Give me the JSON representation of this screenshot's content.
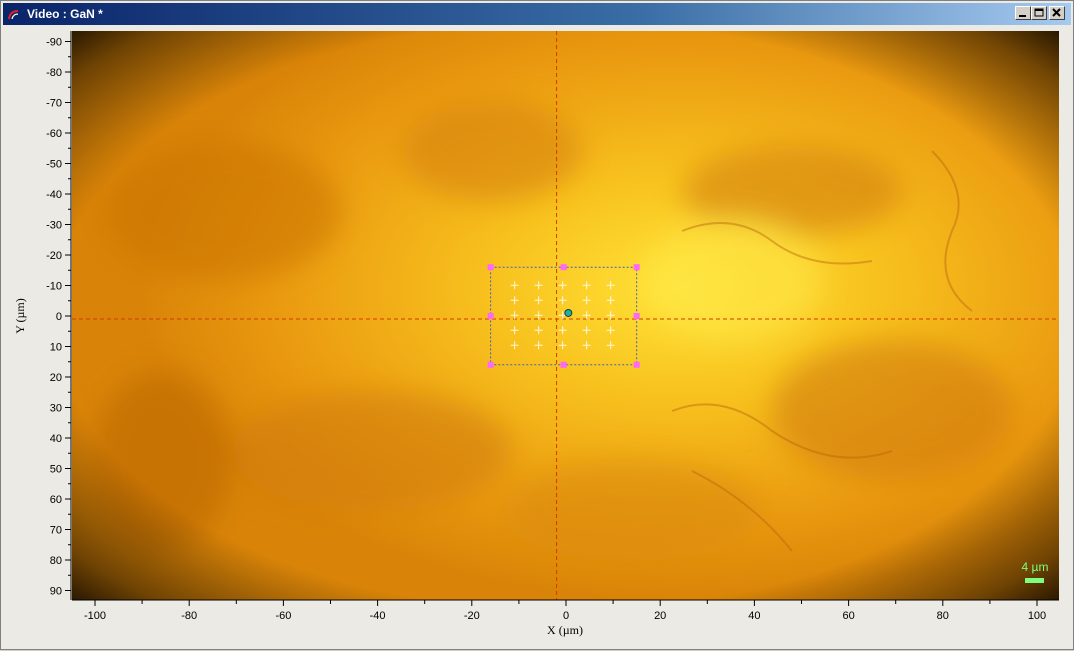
{
  "window": {
    "title": "Video : GaN *",
    "buttons": [
      "minimize",
      "restore",
      "close"
    ]
  },
  "axes": {
    "x_label": "X (µm)",
    "y_label": "Y (µm)",
    "x_ticks": [
      "-100",
      "-80",
      "-60",
      "-40",
      "-20",
      "0",
      "20",
      "40",
      "60",
      "80",
      "100"
    ],
    "y_ticks": [
      "-90",
      "-80",
      "-70",
      "-60",
      "-50",
      "-40",
      "-30",
      "-20",
      "-10",
      "0",
      "10",
      "20",
      "30",
      "40",
      "50",
      "60",
      "70",
      "80",
      "90"
    ]
  },
  "scale_bar": {
    "label": "4 µm",
    "color": "#7cff7c"
  },
  "crosshair": {
    "x": -2,
    "y": 1,
    "color": "#d43a00"
  },
  "selection": {
    "x_range": [
      -16,
      15
    ],
    "y_range": [
      -16,
      16
    ],
    "grid_cols": 5,
    "grid_rows": 5,
    "handle_color": "#ff66ff",
    "center_marker_color": "#20b0a0"
  },
  "colors": {
    "image_base": "#e6940e",
    "image_highlight": "#ffe030",
    "vignette": "#1a0f00"
  },
  "icons": {
    "title": "video-icon",
    "minimize": "minimize-icon",
    "restore": "restore-icon",
    "close": "close-icon"
  }
}
